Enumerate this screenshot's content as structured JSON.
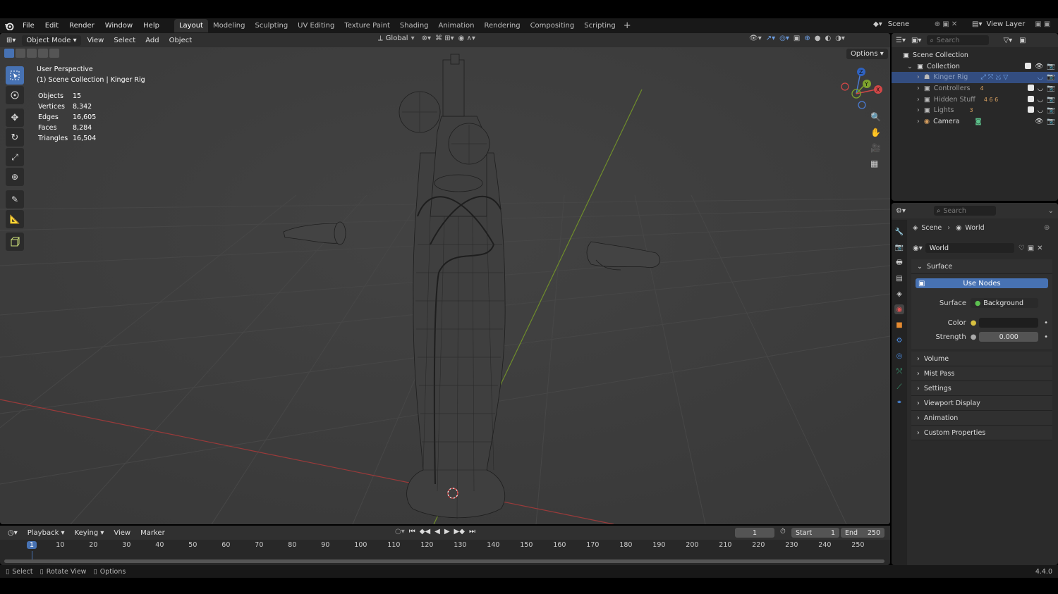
{
  "menu": [
    "File",
    "Edit",
    "Render",
    "Window",
    "Help"
  ],
  "workspaces": [
    "Layout",
    "Modeling",
    "Sculpting",
    "UV Editing",
    "Texture Paint",
    "Shading",
    "Animation",
    "Rendering",
    "Compositing",
    "Scripting"
  ],
  "active_workspace": "Layout",
  "scene_name": "Scene",
  "view_layer": "View Layer",
  "viewport": {
    "mode": "Object Mode",
    "menus": [
      "View",
      "Select",
      "Add",
      "Object"
    ],
    "orientation": "Global",
    "options_label": "Options",
    "perspective": "User Perspective",
    "context": "(1) Scene Collection | Kinger Rig",
    "stats": [
      {
        "label": "Objects",
        "value": "15"
      },
      {
        "label": "Vertices",
        "value": "8,342"
      },
      {
        "label": "Edges",
        "value": "16,605"
      },
      {
        "label": "Faces",
        "value": "8,284"
      },
      {
        "label": "Triangles",
        "value": "16,504"
      }
    ],
    "gizmo_axes": {
      "x": "X",
      "y": "Y",
      "z": "Z"
    }
  },
  "outliner": {
    "search_placeholder": "Search",
    "root": "Scene Collection",
    "collection": "Collection",
    "items": [
      {
        "name": "Kinger Rig",
        "count": ""
      },
      {
        "name": "Controllers",
        "count": "4"
      },
      {
        "name": "Hidden Stuff",
        "count": "4  6  6"
      },
      {
        "name": "Lights",
        "count": "3"
      },
      {
        "name": "Camera",
        "count": ""
      }
    ]
  },
  "properties": {
    "search_placeholder": "Search",
    "breadcrumb": [
      "Scene",
      "World"
    ],
    "world_name": "World",
    "surface_header": "Surface",
    "use_nodes": "Use Nodes",
    "surface_label": "Surface",
    "surface_value": "Background",
    "color_label": "Color",
    "strength_label": "Strength",
    "strength_value": "0.000",
    "sections": [
      "Volume",
      "Mist Pass",
      "Settings",
      "Viewport Display",
      "Animation",
      "Custom Properties"
    ]
  },
  "timeline": {
    "menus": [
      "Playback",
      "Keying",
      "View",
      "Marker"
    ],
    "current_frame": "1",
    "start_label": "Start",
    "start": "1",
    "end_label": "End",
    "end": "250",
    "ticks": [
      "1",
      "10",
      "20",
      "30",
      "40",
      "50",
      "60",
      "70",
      "80",
      "90",
      "100",
      "110",
      "120",
      "130",
      "140",
      "150",
      "160",
      "170",
      "180",
      "190",
      "200",
      "210",
      "220",
      "230",
      "240",
      "250"
    ]
  },
  "statusbar": {
    "items": [
      "Select",
      "Rotate View",
      "Options"
    ],
    "version": "4.4.0"
  }
}
